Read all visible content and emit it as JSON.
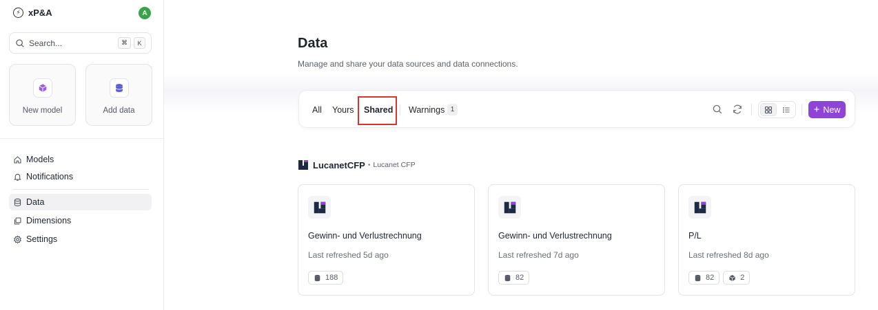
{
  "app": {
    "brand_glyph": "⚡",
    "brand": "xP&A",
    "avatar_initial": "A",
    "avatar_color": "#3aa34a",
    "accent_color": "#8e44d6"
  },
  "search": {
    "placeholder": "Search...",
    "shortcut_keys": [
      "⌘",
      "K"
    ]
  },
  "quick_actions": [
    {
      "label": "New model",
      "icon": "cube-icon"
    },
    {
      "label": "Add data",
      "icon": "database-icon"
    }
  ],
  "nav": {
    "top": [
      {
        "label": "Models",
        "icon": "home-icon"
      },
      {
        "label": "Notifications",
        "icon": "bell-icon"
      }
    ],
    "bottom": [
      {
        "label": "Data",
        "icon": "database-icon",
        "active": true
      },
      {
        "label": "Dimensions",
        "icon": "copy-icon"
      },
      {
        "label": "Settings",
        "icon": "gear-icon"
      }
    ]
  },
  "page": {
    "title": "Data",
    "subtitle": "Manage and share your data sources and data connections."
  },
  "toolbar": {
    "tabs": [
      {
        "label": "All"
      },
      {
        "label": "Yours"
      },
      {
        "label": "Shared",
        "highlighted": true
      },
      {
        "label": "Warnings",
        "badge": "1"
      }
    ],
    "new_label": "New",
    "new_glyph": "+"
  },
  "section": {
    "name": "LucanetCFP",
    "separator": "•",
    "subtitle": "Lucanet CFP"
  },
  "cards": [
    {
      "title": "Gewinn- und Verlustrechnung",
      "meta": "Last refreshed 5d ago",
      "chips": [
        {
          "icon": "database-icon",
          "value": "188"
        }
      ]
    },
    {
      "title": "Gewinn- und Verlustrechnung",
      "meta": "Last refreshed 7d ago",
      "chips": [
        {
          "icon": "database-icon",
          "value": "82"
        }
      ]
    },
    {
      "title": "P/L",
      "meta": "Last refreshed 8d ago",
      "chips": [
        {
          "icon": "database-icon",
          "value": "82"
        },
        {
          "icon": "cube-icon",
          "value": "2"
        }
      ]
    }
  ]
}
